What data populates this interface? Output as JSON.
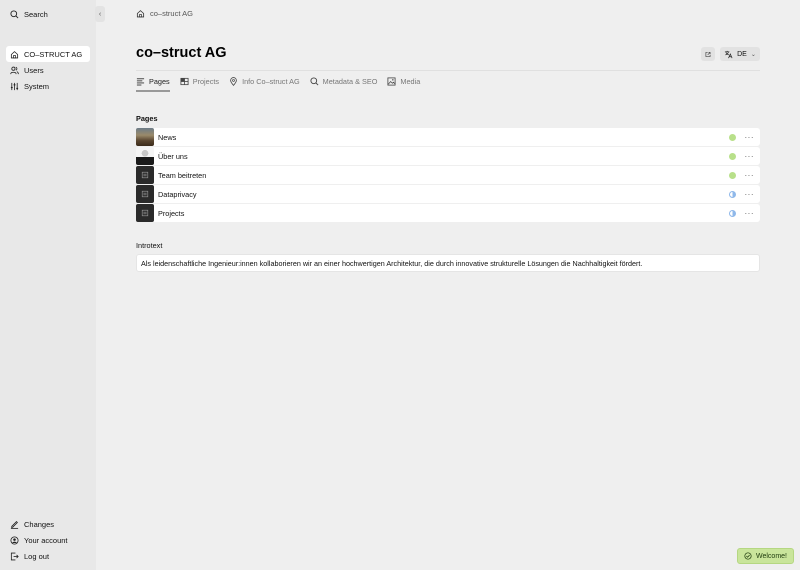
{
  "sidebar": {
    "search_label": "Search",
    "collapse_icon": "‹",
    "nav": [
      {
        "label": "CO–STRUCT AG",
        "icon": "home-icon",
        "active": true
      },
      {
        "label": "Users",
        "icon": "users-icon",
        "active": false
      },
      {
        "label": "System",
        "icon": "sliders-icon",
        "active": false
      }
    ],
    "bottom": [
      {
        "label": "Changes",
        "icon": "pen-icon"
      },
      {
        "label": "Your account",
        "icon": "account-icon"
      },
      {
        "label": "Log out",
        "icon": "logout-icon"
      }
    ]
  },
  "breadcrumb": {
    "label": "co–struct AG"
  },
  "page": {
    "title": "co–struct AG",
    "language": "DE",
    "tabs": [
      {
        "label": "Pages",
        "icon": "list-icon",
        "active": true
      },
      {
        "label": "Projects",
        "icon": "grid-icon",
        "active": false
      },
      {
        "label": "Info Co–struct AG",
        "icon": "pin-icon",
        "active": false
      },
      {
        "label": "Metadata & SEO",
        "icon": "search-icon",
        "active": false
      },
      {
        "label": "Media",
        "icon": "image-icon",
        "active": false
      }
    ]
  },
  "pages_section": {
    "label": "Pages",
    "items": [
      {
        "name": "News",
        "status": "listed",
        "status_color": "#b8e08a",
        "thumb": "photo-landscape"
      },
      {
        "name": "Über uns",
        "status": "listed",
        "status_color": "#b8e08a",
        "thumb": "photo-portrait"
      },
      {
        "name": "Team beitreten",
        "status": "listed",
        "status_color": "#b8e08a",
        "thumb": "placeholder"
      },
      {
        "name": "Dataprivacy",
        "status": "unlisted",
        "status_color": "#8fb8ea",
        "thumb": "placeholder"
      },
      {
        "name": "Projects",
        "status": "unlisted",
        "status_color": "#8fb8ea",
        "thumb": "placeholder"
      }
    ],
    "more_label": "···"
  },
  "intro_section": {
    "label": "Introtext",
    "value": "Als leidenschaftliche Ingenieur:innen kollaborieren wir an einer hochwertigen Architektur, die durch innovative strukturelle Lösungen die Nachhaltigkeit fördert."
  },
  "toast": {
    "label": "Welcome!",
    "color": "#c9e59b"
  }
}
